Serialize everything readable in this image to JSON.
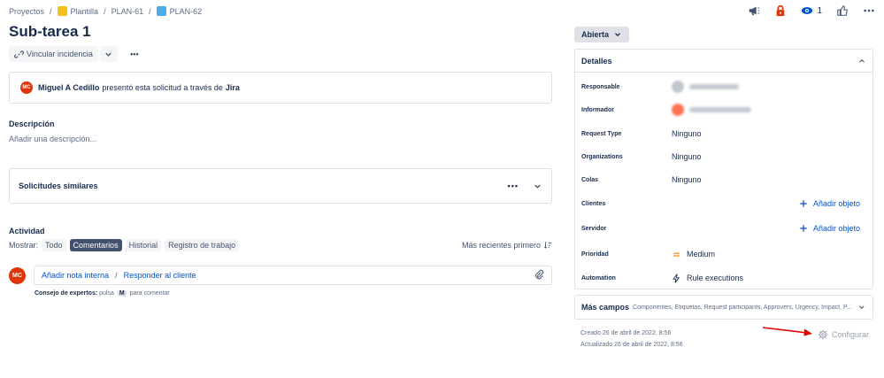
{
  "breadcrumb": {
    "projects": "Proyectos",
    "sep": "/",
    "template": "Plantilla",
    "parent": "PLAN-61",
    "current": "PLAN-62"
  },
  "top_actions": {
    "watchers_count": "1"
  },
  "issue": {
    "title": "Sub-tarea 1"
  },
  "toolbar": {
    "link_label": "Vincular incidencia",
    "more": "•••"
  },
  "request": {
    "avatar_initials": "MC",
    "requester": "Miguel A Cedillo",
    "middle_text": "presentó esta solicitud a través de",
    "channel": "Jira"
  },
  "description": {
    "label": "Descripción",
    "placeholder": "Añadir una descripción..."
  },
  "similar": {
    "label": "Solicitudes similares",
    "more": "•••"
  },
  "activity": {
    "label": "Actividad",
    "show_label": "Mostrar:",
    "filters": [
      "Todo",
      "Comentarios",
      "Historial",
      "Registro de trabajo"
    ],
    "active_filter": "Comentarios",
    "sort": "Más recientes primero"
  },
  "comment": {
    "avatar_initials": "MC",
    "internal_note": "Añadir nota interna",
    "slash": "/",
    "reply": "Responder al cliente",
    "tip_prefix": "Consejo de expertos:",
    "tip_press": "pulsa",
    "tip_key": "M",
    "tip_suffix": "para comentar"
  },
  "status": {
    "label": "Abierta"
  },
  "details": {
    "header": "Detalles",
    "rows": [
      {
        "label": "Responsable"
      },
      {
        "label": "Informador"
      },
      {
        "label": "Request Type",
        "value": "Ninguno"
      },
      {
        "label": "Organizations",
        "value": "Ninguno"
      },
      {
        "label": "Colas",
        "value": "Ninguno"
      },
      {
        "label": "Clientes",
        "value": "Añadir objeto"
      },
      {
        "label": "Servidor",
        "value": "Añadir objeto"
      },
      {
        "label": "Prioridad",
        "value": "Medium"
      },
      {
        "label": "Automation",
        "value": "Rule executions"
      }
    ]
  },
  "more_fields": {
    "label": "Más campos",
    "list": "Componentes, Etiquetas, Request participants, Approvers, Urgency, Impact, P..."
  },
  "meta": {
    "created": "Creado 26 de abril de 2022, 8:56",
    "updated": "Actualizado 26 de abril de 2022, 8:56"
  },
  "configure": {
    "label": "Configurar"
  },
  "colors": {
    "accent": "#0052cc",
    "annotation_arrow": "#e00000",
    "avatar": "#de350b",
    "priority": "#ff991f"
  }
}
